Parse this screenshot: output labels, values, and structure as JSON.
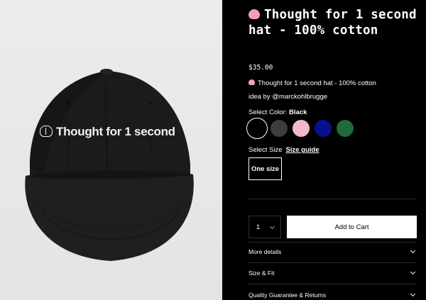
{
  "product": {
    "image_alt": "Black cap embroidered with Thought for 1 second",
    "cap_embroidery": "Thought for 1 second",
    "title": "Thought for 1 second hat - 100% cotton",
    "title_icon": "brain-emoji",
    "price": "$35.00",
    "description": "Thought for 1 second hat - 100% cotton",
    "byline": "idea by @marckohlbrugge"
  },
  "color": {
    "label": "Select Color:",
    "selected": "Black",
    "options": [
      {
        "name": "Black",
        "hex": "#000000"
      },
      {
        "name": "Charcoal",
        "hex": "#3d3d40"
      },
      {
        "name": "Pink",
        "hex": "#f5b8c6"
      },
      {
        "name": "Navy",
        "hex": "#0a0f8f"
      },
      {
        "name": "Green",
        "hex": "#1f6b3a"
      }
    ]
  },
  "size": {
    "label": "Select Size",
    "guide_label": "Size guide",
    "options": [
      "One size"
    ]
  },
  "cart": {
    "quantity": "1",
    "add_label": "Add to Cart"
  },
  "accordions": [
    {
      "label": "More details"
    },
    {
      "label": "Size & Fit"
    },
    {
      "label": "Quality Guarantee & Returns"
    }
  ]
}
